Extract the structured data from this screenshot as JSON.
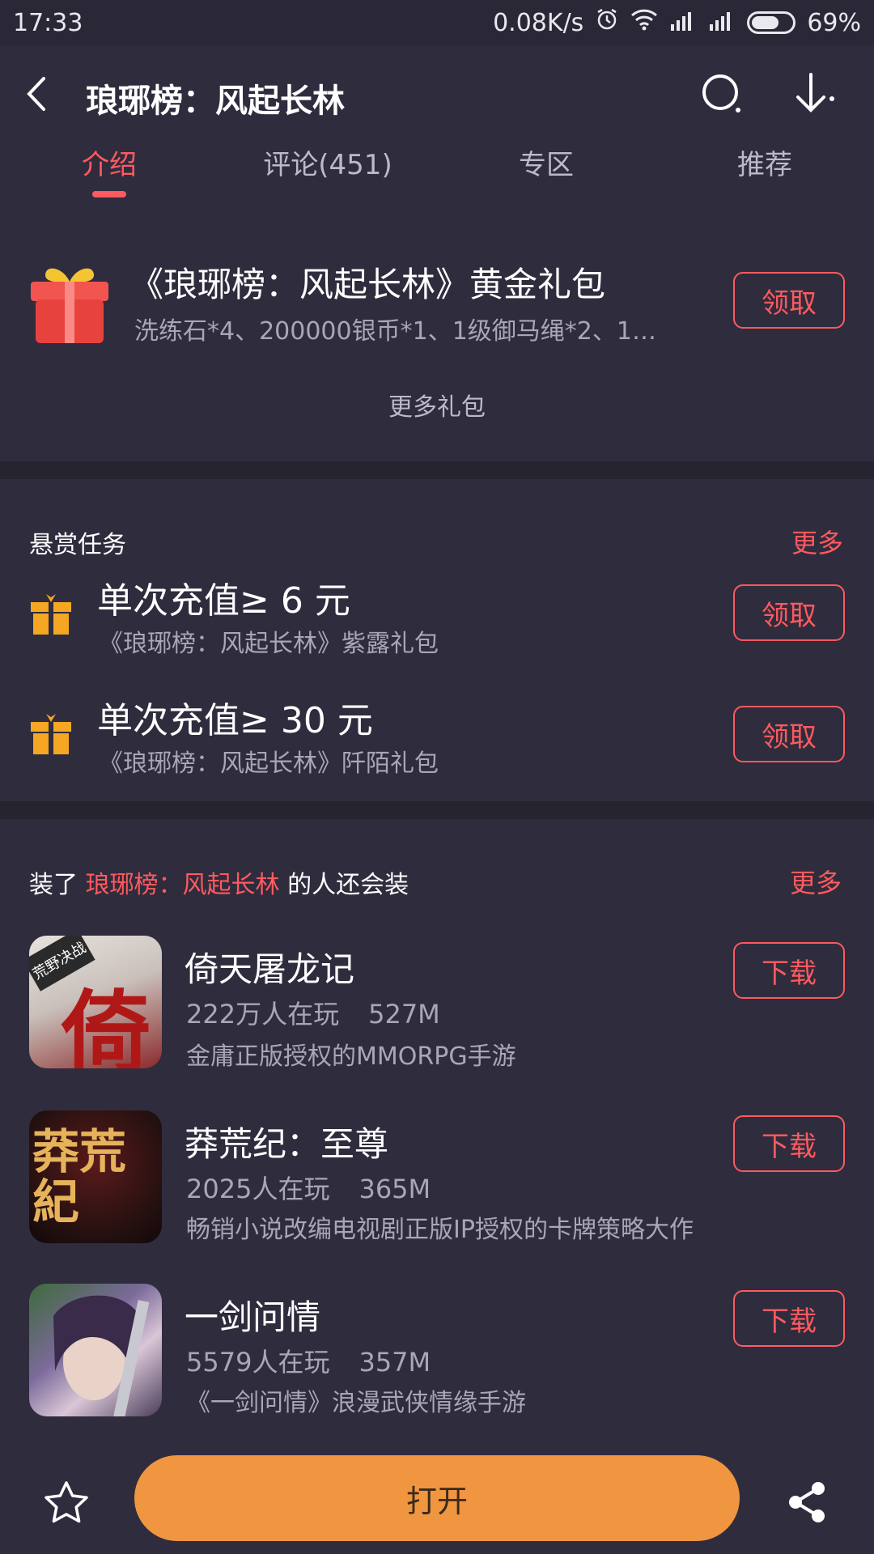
{
  "status_bar": {
    "time": "17:33",
    "network_speed": "0.08K/s",
    "battery": "69%",
    "battery_level": 0.69
  },
  "header": {
    "title": "琅琊榜：风起长林"
  },
  "tabs": [
    {
      "label": "介绍",
      "active": true
    },
    {
      "label": "评论(451)",
      "active": false
    },
    {
      "label": "专区",
      "active": false
    },
    {
      "label": "推荐",
      "active": false
    }
  ],
  "gift": {
    "title": "《琅琊榜：风起长林》黄金礼包",
    "description": "洗练石*4、200000银币*1、1级御马绳*2、1级...",
    "button": "领取",
    "more": "更多礼包"
  },
  "tasks": {
    "title": "悬赏任务",
    "more": "更多",
    "items": [
      {
        "title": "单次充值≥  6  元",
        "subtitle": "《琅琊榜：风起长林》紫露礼包",
        "button": "领取"
      },
      {
        "title": "单次充值≥  30  元",
        "subtitle": "《琅琊榜：风起长林》阡陌礼包",
        "button": "领取"
      }
    ]
  },
  "related": {
    "prefix": "装了 ",
    "highlight": "琅琊榜：风起长林",
    "suffix": " 的人还会装",
    "more": "更多",
    "apps": [
      {
        "name": "倚天屠龙记",
        "players": "222万人在玩",
        "size": "527M",
        "desc": "金庸正版授权的MMORPG手游",
        "button": "下载",
        "icon_text": "倚",
        "badge": "荒野决战"
      },
      {
        "name": "莽荒纪：至尊",
        "players": "2025人在玩",
        "size": "365M",
        "desc": "畅销小说改编电视剧正版IP授权的卡牌策略大作",
        "button": "下载",
        "icon_text": "莽荒紀"
      },
      {
        "name": "一剑问情",
        "players": "5579人在玩",
        "size": "357M",
        "desc": "《一剑问情》浪漫武侠情缘手游",
        "button": "下载"
      }
    ]
  },
  "bottom": {
    "open_label": "打开"
  },
  "colors": {
    "background": "#2f2c3d",
    "accent": "#ff5a5f",
    "open_button": "#f09640",
    "divider": "#26242f"
  }
}
